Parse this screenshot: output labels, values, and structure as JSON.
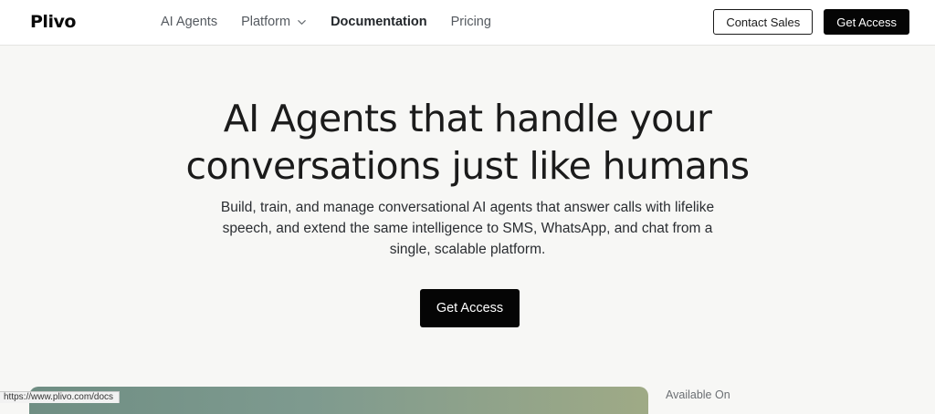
{
  "header": {
    "logo": "Plivo",
    "nav": [
      {
        "label": "AI Agents"
      },
      {
        "label": "Platform"
      },
      {
        "label": "Documentation"
      },
      {
        "label": "Pricing"
      }
    ],
    "contact_sales": "Contact Sales",
    "get_access": "Get Access"
  },
  "hero": {
    "title_line1": "AI Agents that handle your",
    "title_line2": "conversations just like humans",
    "subtitle": "Build, train, and manage conversational AI agents that answer calls with lifelike speech, and extend the same intelligence to SMS, WhatsApp, and chat from a single, scalable platform.",
    "cta": "Get Access"
  },
  "available_on": "Available On",
  "status_bar": {
    "url": "https://www.plivo.com/docs"
  },
  "colors": {
    "accent": "#050505",
    "background": "#f7f7f5"
  }
}
